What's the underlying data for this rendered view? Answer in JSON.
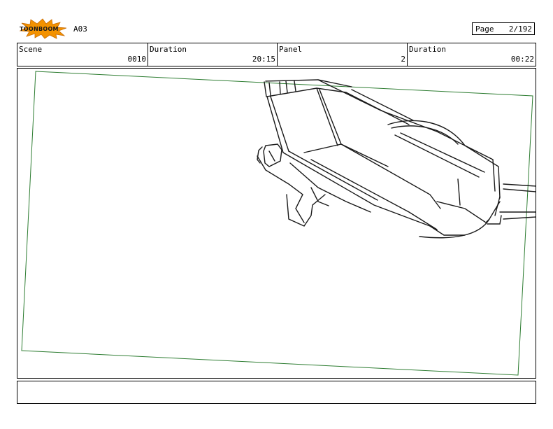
{
  "header": {
    "logo_text": "TOONBOOM",
    "scene_id": "A03",
    "page_label": "Page",
    "page_value": "2/192"
  },
  "info": [
    {
      "label": "Scene",
      "value": "0010"
    },
    {
      "label": "Duration",
      "value": "20:15"
    },
    {
      "label": "Panel",
      "value": "2"
    },
    {
      "label": "Duration",
      "value": "00:22"
    }
  ],
  "panel": {
    "frame_color": "#2e7d32",
    "sketch_color": "#1a1a1a"
  },
  "logo_colors": {
    "burst": "#f39200",
    "text": "#1a1a1a"
  }
}
